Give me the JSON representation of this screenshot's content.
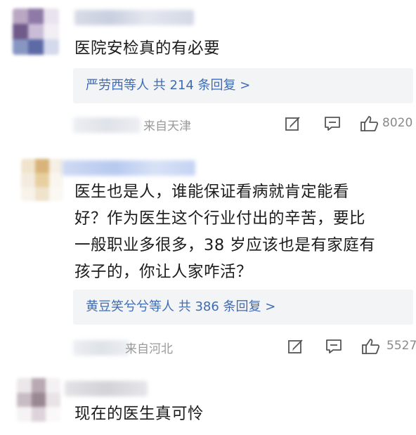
{
  "comments": [
    {
      "text": "医院安检真的有必要",
      "reply_summary": "严劳西等人 共 214 条回复 >",
      "source": "来自天津",
      "likes": "8020"
    },
    {
      "text": "医生也是人，谁能保证看病就肯定能看好？作为医生这个行业付出的辛苦，要比一般职业多很多，38岁应该也是有家庭有孩子的，你让人家咋活？",
      "text_lines": [
        "医生也是人，谁能保证看病就肯定能看",
        "好？作为医生这个行业付出的辛苦，要比",
        "一般职业多很多，38 岁应该也是有家庭有",
        "孩子的，你让人家咋活？"
      ],
      "reply_summary": "黄豆笑兮兮等人 共 386 条回复 >",
      "source": "来自河北",
      "likes": "5527"
    },
    {
      "text": "现在的医生真可怜"
    }
  ],
  "icons": {
    "edit": "edit-icon",
    "comment": "comment-icon",
    "like": "thumbs-up-icon"
  },
  "colors": {
    "reply_link": "#3f6bb5",
    "reply_bg": "#f3f4f6",
    "meta_text": "#9a9a9a"
  }
}
